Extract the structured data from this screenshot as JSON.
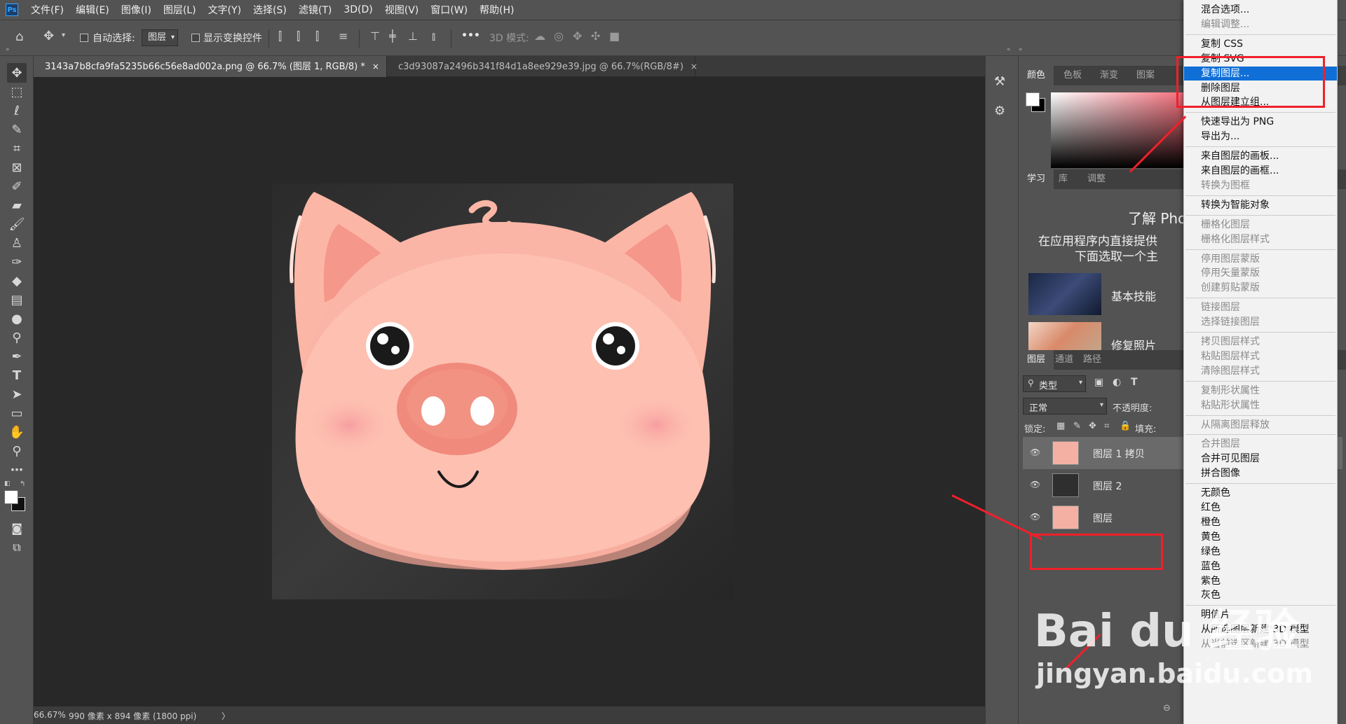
{
  "app": {
    "logo": "Ps"
  },
  "menubar": [
    "文件(F)",
    "编辑(E)",
    "图像(I)",
    "图层(L)",
    "文字(Y)",
    "选择(S)",
    "滤镜(T)",
    "3D(D)",
    "视图(V)",
    "窗口(W)",
    "帮助(H)"
  ],
  "options": {
    "auto_select_label": "自动选择:",
    "auto_select_value": "图层",
    "show_transform_label": "显示变换控件",
    "three_d_label": "3D 模式:",
    "more": "•••"
  },
  "tabs": [
    {
      "label": "3143a7b8cfa9fa5235b66c56e8ad002a.png @ 66.7% (图层 1, RGB/8) *",
      "close": "×"
    },
    {
      "label": "c3d93087a2496b341f84d1a8ee929e39.jpg @ 66.7%(RGB/8#)",
      "close": "×"
    }
  ],
  "status": {
    "zoom": "66.67%",
    "doc_info": "990 像素 x 894 像素 (1800 ppi)",
    "arrow": "〉"
  },
  "panels": {
    "color_tabs": [
      "颜色",
      "色板",
      "渐变",
      "图案"
    ],
    "learn_tabs": [
      "学习",
      "库",
      "调整"
    ],
    "learn_title": "了解 Pho",
    "learn_desc1": "在应用程序内直接提供",
    "learn_desc2": "下面选取一个主",
    "learn_items": [
      "基本技能",
      "修复照片"
    ],
    "layers_tabs": [
      "图层",
      "通道",
      "路径"
    ],
    "filter_label": "类型",
    "blend_mode": "正常",
    "opacity_label": "不透明度:",
    "lock_label": "锁定:",
    "fill_label": "填充:",
    "layers": [
      {
        "name": "图层 1 拷贝"
      },
      {
        "name": "图层 2"
      },
      {
        "name": "图层"
      }
    ]
  },
  "context_menu": [
    {
      "label": "混合选项...",
      "enabled": true
    },
    {
      "label": "编辑调整...",
      "enabled": false
    },
    {
      "sep": true
    },
    {
      "label": "复制 CSS",
      "enabled": true
    },
    {
      "label": "复制 SVG",
      "enabled": true
    },
    {
      "label": "复制图层...",
      "enabled": true,
      "highlighted": true
    },
    {
      "label": "删除图层",
      "enabled": true
    },
    {
      "label": "从图层建立组...",
      "enabled": true
    },
    {
      "sep": true
    },
    {
      "label": "快速导出为 PNG",
      "enabled": true
    },
    {
      "label": "导出为...",
      "enabled": true
    },
    {
      "sep": true
    },
    {
      "label": "来自图层的画板...",
      "enabled": true
    },
    {
      "label": "来自图层的画框...",
      "enabled": true
    },
    {
      "label": "转换为图框",
      "enabled": false
    },
    {
      "sep": true
    },
    {
      "label": "转换为智能对象",
      "enabled": true
    },
    {
      "sep": true
    },
    {
      "label": "栅格化图层",
      "enabled": false
    },
    {
      "label": "栅格化图层样式",
      "enabled": false
    },
    {
      "sep": true
    },
    {
      "label": "停用图层蒙版",
      "enabled": false
    },
    {
      "label": "停用矢量蒙版",
      "enabled": false
    },
    {
      "label": "创建剪贴蒙版",
      "enabled": false
    },
    {
      "sep": true
    },
    {
      "label": "链接图层",
      "enabled": false
    },
    {
      "label": "选择链接图层",
      "enabled": false
    },
    {
      "sep": true
    },
    {
      "label": "拷贝图层样式",
      "enabled": false
    },
    {
      "label": "粘贴图层样式",
      "enabled": false
    },
    {
      "label": "清除图层样式",
      "enabled": false
    },
    {
      "sep": true
    },
    {
      "label": "复制形状属性",
      "enabled": false
    },
    {
      "label": "粘贴形状属性",
      "enabled": false
    },
    {
      "sep": true
    },
    {
      "label": "从隔离图层释放",
      "enabled": false
    },
    {
      "sep": true
    },
    {
      "label": "合并图层",
      "enabled": false
    },
    {
      "label": "合并可见图层",
      "enabled": true
    },
    {
      "label": "拼合图像",
      "enabled": true
    },
    {
      "sep": true
    },
    {
      "label": "无颜色",
      "enabled": true
    },
    {
      "label": "红色",
      "enabled": true
    },
    {
      "label": "橙色",
      "enabled": true
    },
    {
      "label": "黄色",
      "enabled": true
    },
    {
      "label": "绿色",
      "enabled": true
    },
    {
      "label": "蓝色",
      "enabled": true
    },
    {
      "label": "紫色",
      "enabled": true
    },
    {
      "label": "灰色",
      "enabled": true
    },
    {
      "sep": true
    },
    {
      "label": "明信片",
      "enabled": true
    },
    {
      "label": "从所选图层新建 3D 模型",
      "enabled": true
    },
    {
      "label": "从当前选区新建 3D 模型",
      "enabled": false
    }
  ],
  "watermark": {
    "brand": "Bai du 经验",
    "url": "jingyan.baidu.com"
  },
  "colors": {
    "accent": "#0f6fd6",
    "annotation": "#f0202a",
    "pig": "#fcb6a6",
    "snout": "#f08a7c"
  }
}
